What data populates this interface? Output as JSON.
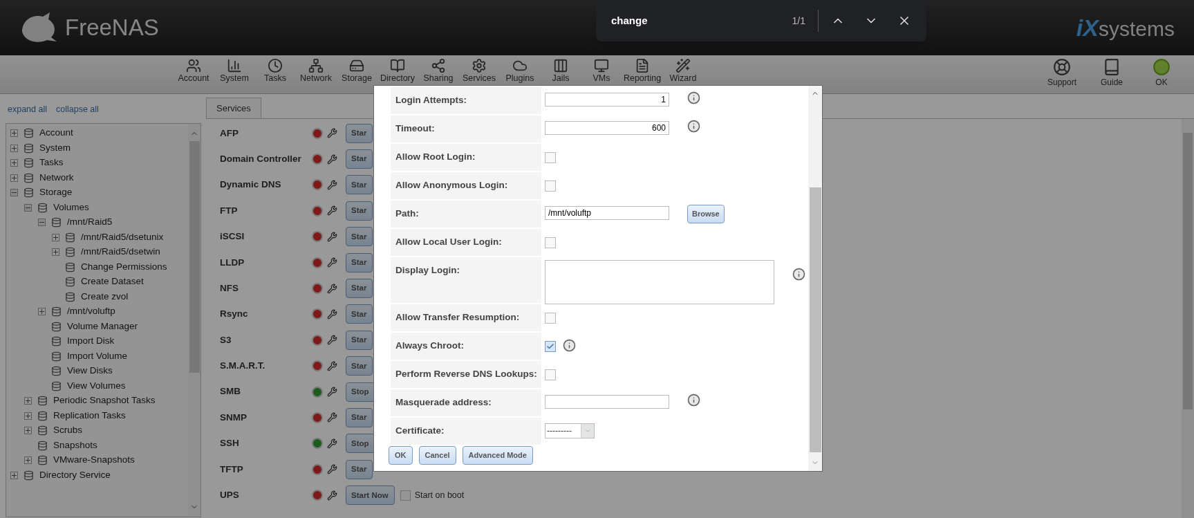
{
  "find_bar": {
    "query": "change",
    "count": "1/1"
  },
  "header": {
    "logo": "FreeNAS",
    "brand_prefix": "iX",
    "brand_suffix": "systems"
  },
  "toolbar": {
    "items": [
      {
        "label": "Account"
      },
      {
        "label": "System"
      },
      {
        "label": "Tasks"
      },
      {
        "label": "Network"
      },
      {
        "label": "Storage"
      },
      {
        "label": "Directory"
      },
      {
        "label": "Sharing"
      },
      {
        "label": "Services"
      },
      {
        "label": "Plugins"
      },
      {
        "label": "Jails"
      },
      {
        "label": "VMs"
      },
      {
        "label": "Reporting"
      },
      {
        "label": "Wizard"
      }
    ],
    "right_items": [
      {
        "label": "Support"
      },
      {
        "label": "Guide"
      },
      {
        "label": "OK"
      }
    ]
  },
  "tree": {
    "expand_all": "expand all",
    "collapse_all": "collapse all",
    "items": [
      {
        "label": "Account",
        "kind": "node",
        "expanded": false
      },
      {
        "label": "System",
        "kind": "node",
        "expanded": false
      },
      {
        "label": "Tasks",
        "kind": "node",
        "expanded": false
      },
      {
        "label": "Network",
        "kind": "node",
        "expanded": false
      },
      {
        "label": "Storage",
        "kind": "node",
        "expanded": true,
        "children": [
          {
            "label": "Volumes",
            "kind": "node",
            "expanded": true,
            "children": [
              {
                "label": "/mnt/Raid5",
                "kind": "node",
                "expanded": true,
                "children": [
                  {
                    "label": "/mnt/Raid5/dsetunix",
                    "kind": "node",
                    "expanded": false
                  },
                  {
                    "label": "/mnt/Raid5/dsetwin",
                    "kind": "node",
                    "expanded": false
                  },
                  {
                    "label": "Change Permissions",
                    "kind": "leaf"
                  },
                  {
                    "label": "Create Dataset",
                    "kind": "leaf"
                  },
                  {
                    "label": "Create zvol",
                    "kind": "leaf"
                  }
                ]
              },
              {
                "label": "/mnt/voluftp",
                "kind": "node",
                "expanded": false
              },
              {
                "label": "Volume Manager",
                "kind": "leaf"
              },
              {
                "label": "Import Disk",
                "kind": "leaf"
              },
              {
                "label": "Import Volume",
                "kind": "leaf"
              },
              {
                "label": "View Disks",
                "kind": "leaf"
              },
              {
                "label": "View Volumes",
                "kind": "leaf"
              }
            ]
          },
          {
            "label": "Periodic Snapshot Tasks",
            "kind": "node",
            "expanded": false
          },
          {
            "label": "Replication Tasks",
            "kind": "node",
            "expanded": false
          },
          {
            "label": "Scrubs",
            "kind": "node",
            "expanded": false
          },
          {
            "label": "Snapshots",
            "kind": "leaf"
          },
          {
            "label": "VMware-Snapshots",
            "kind": "node",
            "expanded": false
          }
        ]
      },
      {
        "label": "Directory Service",
        "kind": "node",
        "expanded": false
      }
    ]
  },
  "tabs": [
    {
      "label": "Services",
      "selected": true
    }
  ],
  "services": [
    {
      "name": "AFP",
      "running": false,
      "button": "Star"
    },
    {
      "name": "Domain Controller",
      "running": false,
      "button": "Star"
    },
    {
      "name": "Dynamic DNS",
      "running": false,
      "button": "Star"
    },
    {
      "name": "FTP",
      "running": false,
      "button": "Star"
    },
    {
      "name": "iSCSI",
      "running": false,
      "button": "Star"
    },
    {
      "name": "LLDP",
      "running": false,
      "button": "Star"
    },
    {
      "name": "NFS",
      "running": false,
      "button": "Star"
    },
    {
      "name": "Rsync",
      "running": false,
      "button": "Star"
    },
    {
      "name": "S3",
      "running": false,
      "button": "Star"
    },
    {
      "name": "S.M.A.R.T.",
      "running": false,
      "button": "Star"
    },
    {
      "name": "SMB",
      "running": true,
      "button": "Stop"
    },
    {
      "name": "SNMP",
      "running": false,
      "button": "Star"
    },
    {
      "name": "SSH",
      "running": true,
      "button": "Stop"
    },
    {
      "name": "TFTP",
      "running": false,
      "button": "Star"
    },
    {
      "name": "UPS",
      "running": false,
      "button": "Start Now",
      "boot_label": "Start on boot",
      "start_on_boot": false
    }
  ],
  "dialog": {
    "fields": [
      {
        "label": "Login Attempts:",
        "kind": "number",
        "value": "1",
        "info": true
      },
      {
        "label": "Timeout:",
        "kind": "number",
        "value": "600",
        "info": true
      },
      {
        "label": "Allow Root Login:",
        "kind": "checkbox",
        "checked": false,
        "info": false
      },
      {
        "label": "Allow Anonymous Login:",
        "kind": "checkbox",
        "checked": false,
        "info": false
      },
      {
        "label": "Path:",
        "kind": "path",
        "value": "/mnt/voluftp",
        "button": "Browse",
        "info": false
      },
      {
        "label": "Allow Local User Login:",
        "kind": "checkbox",
        "checked": false,
        "info": false
      },
      {
        "label": "Display Login:",
        "kind": "textarea",
        "info": true
      },
      {
        "label": "Allow Transfer Resumption:",
        "kind": "checkbox",
        "checked": false,
        "info": false
      },
      {
        "label": "Always Chroot:",
        "kind": "checkbox",
        "checked": true,
        "info": true
      },
      {
        "label": "Perform Reverse DNS Lookups:",
        "kind": "checkbox",
        "checked": false,
        "info": false
      },
      {
        "label": "Masquerade address:",
        "kind": "text",
        "info": true
      },
      {
        "label": "Certificate:",
        "kind": "select",
        "value": "---------",
        "info": false
      }
    ],
    "buttons": [
      "OK",
      "Cancel",
      "Advanced Mode"
    ]
  }
}
